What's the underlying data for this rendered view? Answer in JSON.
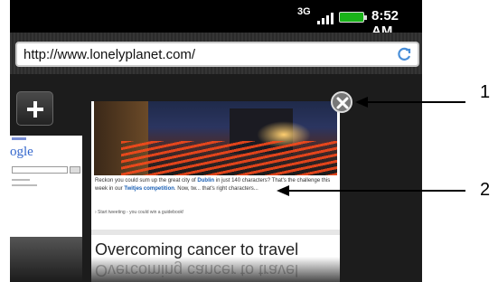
{
  "status_bar": {
    "network": "3G",
    "time": "8:52 AM"
  },
  "url_bar": {
    "url": "http://www.lonelyplanet.com/"
  },
  "left_window": {
    "logo_text": "ogle"
  },
  "main_window": {
    "caption_part1": "Reckon you could sum up the great city of ",
    "caption_city": "Dublin",
    "caption_part2": " in just 140 characters? That's the challenge this week in our ",
    "caption_link": "Twitjes competition",
    "caption_part3": ". Now, tw... that's right characters...",
    "small_link": "› Start tweeting - you could win a guidebook!",
    "headline": "Overcoming cancer to travel"
  },
  "callouts": [
    {
      "number": "1"
    },
    {
      "number": "2"
    }
  ],
  "colors": {
    "battery": "#19b319",
    "link": "#1a5fb4"
  }
}
